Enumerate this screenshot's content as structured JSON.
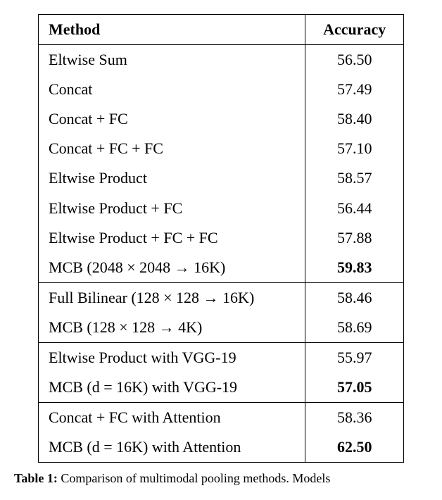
{
  "table": {
    "header_method": "Method",
    "header_accuracy": "Accuracy",
    "rows": [
      {
        "method": "Eltwise Sum",
        "accuracy": "56.50",
        "bold": false,
        "group_end": false
      },
      {
        "method": "Concat",
        "accuracy": "57.49",
        "bold": false,
        "group_end": false
      },
      {
        "method": "Concat + FC",
        "accuracy": "58.40",
        "bold": false,
        "group_end": false
      },
      {
        "method": "Concat + FC + FC",
        "accuracy": "57.10",
        "bold": false,
        "group_end": false
      },
      {
        "method": "Eltwise Product",
        "accuracy": "58.57",
        "bold": false,
        "group_end": false
      },
      {
        "method": "Eltwise Product + FC",
        "accuracy": "56.44",
        "bold": false,
        "group_end": false
      },
      {
        "method": "Eltwise Product + FC + FC",
        "accuracy": "57.88",
        "bold": false,
        "group_end": false
      },
      {
        "method": "MCB (2048 × 2048 → 16K)",
        "accuracy": "59.83",
        "bold": true,
        "group_end": true
      },
      {
        "method": "Full Bilinear (128 × 128 → 16K)",
        "accuracy": "58.46",
        "bold": false,
        "group_end": false
      },
      {
        "method": "MCB (128 × 128 → 4K)",
        "accuracy": "58.69",
        "bold": false,
        "group_end": true
      },
      {
        "method": "Eltwise Product with VGG-19",
        "accuracy": "55.97",
        "bold": false,
        "group_end": false
      },
      {
        "method": "MCB (d = 16K) with VGG-19",
        "accuracy": "57.05",
        "bold": true,
        "group_end": true
      },
      {
        "method": "Concat + FC with Attention",
        "accuracy": "58.36",
        "bold": false,
        "group_end": false
      },
      {
        "method": "MCB (d = 16K) with Attention",
        "accuracy": "62.50",
        "bold": true,
        "group_end": true
      }
    ]
  },
  "caption": {
    "label": "Table 1:",
    "text": " Comparison of multimodal pooling methods. Models"
  }
}
